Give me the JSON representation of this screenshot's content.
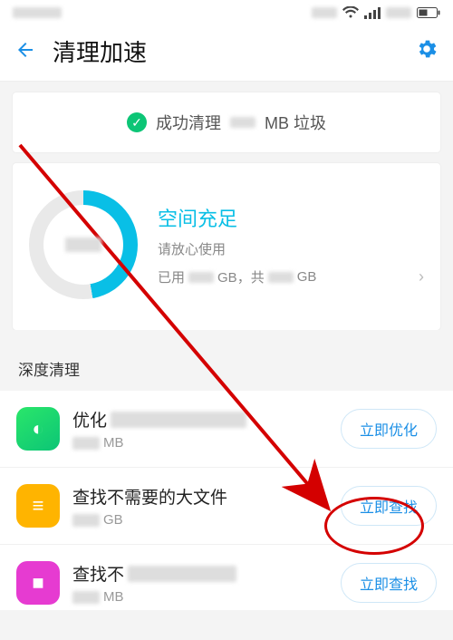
{
  "header": {
    "title": "清理加速"
  },
  "success": {
    "prefix": "成功清理",
    "suffix": "MB 垃圾"
  },
  "storage": {
    "title": "空间充足",
    "subtitle": "请放心使用",
    "used_label": "已用",
    "used_unit": "GB，共",
    "total_unit": "GB"
  },
  "section": {
    "deep_clean": "深度清理"
  },
  "rows": [
    {
      "title_prefix": "优化",
      "size_unit": "MB",
      "action": "立即优化"
    },
    {
      "title": "查找不需要的大文件",
      "size_unit": "GB",
      "action": "立即查找"
    },
    {
      "title_prefix": "查找不",
      "size_unit": "MB",
      "action": "立即查找"
    }
  ]
}
